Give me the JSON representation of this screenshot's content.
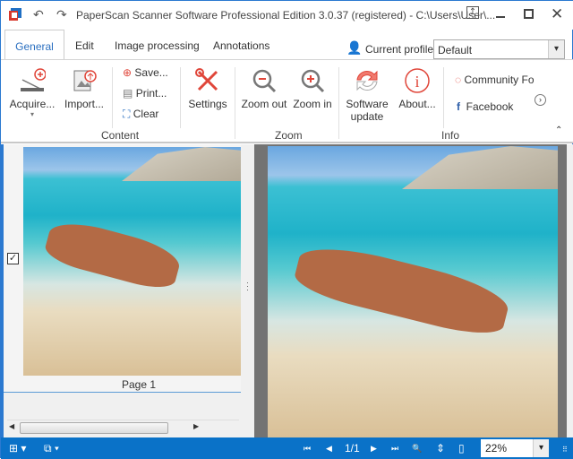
{
  "window": {
    "title": "PaperScan Scanner Software Professional Edition 3.0.37 (registered) - C:\\Users\\User\\...",
    "icons": [
      "app-logo-icon",
      "undo-icon",
      "redo-icon",
      "restore-icon",
      "minimize-icon",
      "maximize-icon",
      "close-icon"
    ]
  },
  "tabs": [
    {
      "label": "General",
      "selected": true
    },
    {
      "label": "Edit"
    },
    {
      "label": "Image processing"
    },
    {
      "label": "Annotations"
    }
  ],
  "profile": {
    "label": "Current profile:",
    "value": "Default"
  },
  "ribbon": {
    "content": {
      "label": "Content",
      "acquire": "Acquire...",
      "import": "Import...",
      "save": "Save...",
      "print": "Print...",
      "clear": "Clear",
      "settings": "Settings"
    },
    "zoom": {
      "label": "Zoom",
      "zoom_out": "Zoom out",
      "zoom_in": "Zoom in"
    },
    "info": {
      "label": "Info",
      "software_update_1": "Software",
      "software_update_2": "update",
      "about": "About...",
      "community": "Community Foi",
      "facebook": "Facebook"
    }
  },
  "thumbnails": [
    {
      "label": "Page 1",
      "checked": true
    }
  ],
  "statusbar": {
    "page": "1/1",
    "zoom": "22%"
  },
  "colors": {
    "accent": "#0a72c8",
    "icon_red": "#e0463a"
  }
}
